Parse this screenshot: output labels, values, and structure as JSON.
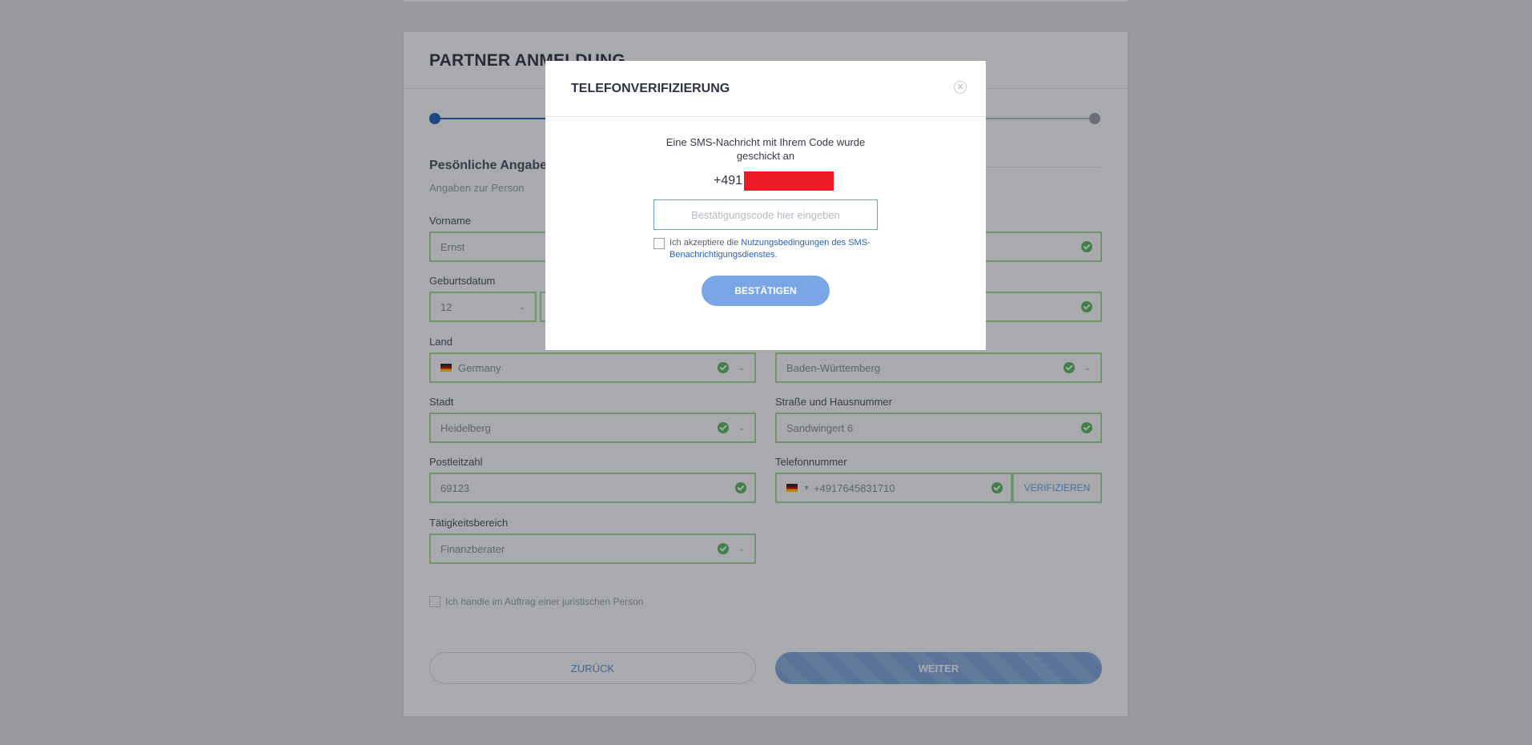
{
  "form": {
    "title": "PARTNER ANMELDUNG",
    "section_title": "Pesönliche Angaben",
    "section_subtitle": "Angaben zur Person",
    "fields": {
      "vorname": {
        "label": "Vorname",
        "value": "Ernst"
      },
      "geburtsdatum": {
        "label": "Geburtsdatum",
        "value": "12"
      },
      "land": {
        "label": "Land",
        "value": "Germany"
      },
      "bundesland": {
        "value": "Baden-Württemberg"
      },
      "stadt": {
        "label": "Stadt",
        "value": "Heidelberg"
      },
      "strasse": {
        "label": "Straße und Hausnummer",
        "value": "Sandwingert 6"
      },
      "postleitzahl": {
        "label": "Postleitzahl",
        "value": "69123"
      },
      "telefon": {
        "label": "Telefonnummer",
        "value": "+4917645831710",
        "verify_label": "VERIFIZIEREN"
      },
      "taetigkeit": {
        "label": "Tätigkeitsbereich",
        "value": "Finanzberater"
      }
    },
    "legal_person_label": "Ich handle im Auftrag einer juristischen Person",
    "back_label": "ZURÜCK",
    "next_label": "WEITER"
  },
  "modal": {
    "title": "TELEFONVERIFIZIERUNG",
    "close_glyph": "✕",
    "message_line1": "Eine SMS-Nachricht mit Ihrem Code wurde",
    "message_line2": "geschickt an",
    "phone_prefix": "+491",
    "code_placeholder": "Bestätigungscode hier eingeben",
    "terms_prefix": "Ich akzeptiere die ",
    "terms_link": "Nutzungsbedingungen des SMS-Benachrichtigungsdienstes",
    "terms_suffix": ".",
    "confirm_label": "BESTÄTIGEN"
  }
}
